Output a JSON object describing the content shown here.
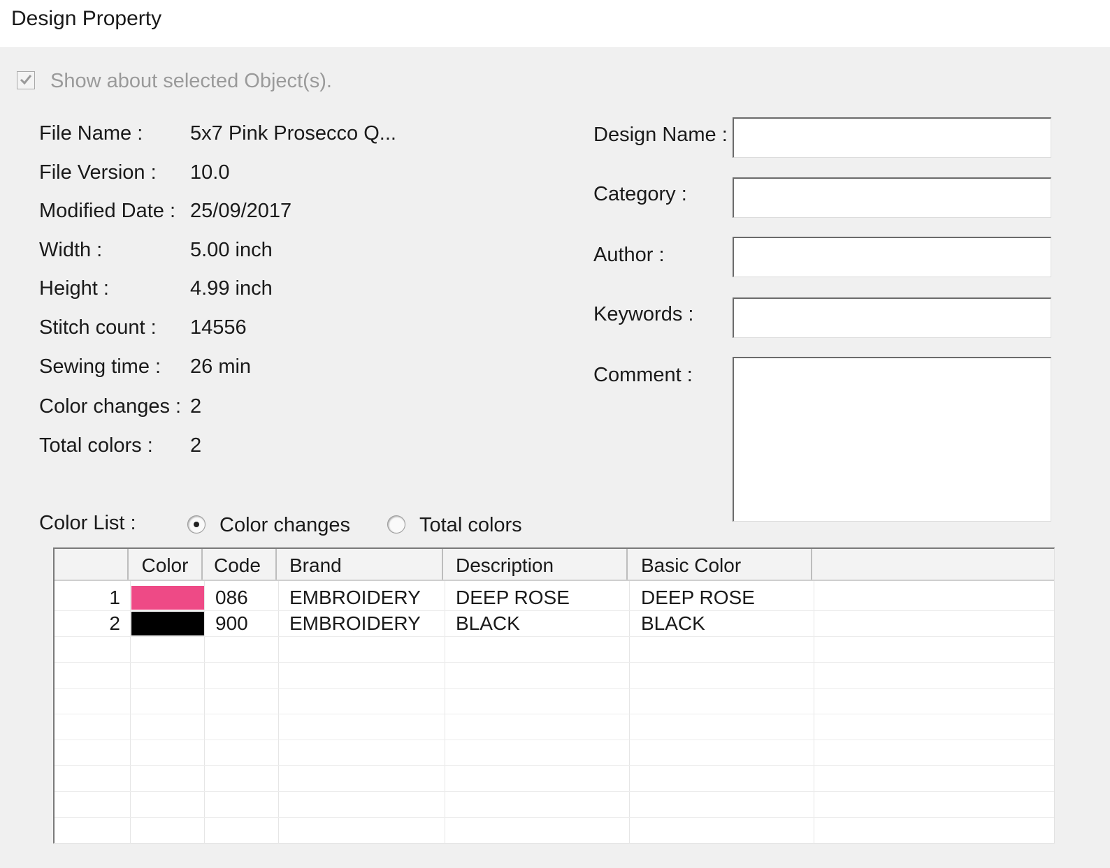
{
  "window": {
    "title": "Design Property"
  },
  "show_selected": {
    "label": "Show about selected Object(s).",
    "checked": true,
    "enabled": false
  },
  "properties": [
    {
      "key": "File Name :",
      "value": "5x7 Pink Prosecco Q..."
    },
    {
      "key": "File Version :",
      "value": "10.0"
    },
    {
      "key": "Modified Date :",
      "value": "25/09/2017"
    },
    {
      "key": "Width :",
      "value": "5.00 inch"
    },
    {
      "key": "Height :",
      "value": "4.99 inch"
    },
    {
      "key": "Stitch count :",
      "value": "14556"
    },
    {
      "key": "Sewing time :",
      "value": "26 min"
    },
    {
      "key": "Color changes :",
      "value": "2"
    },
    {
      "key": "Total colors :",
      "value": "2"
    }
  ],
  "fields": {
    "design_name": {
      "label": "Design Name :",
      "value": ""
    },
    "category": {
      "label": "Category :",
      "value": ""
    },
    "author": {
      "label": "Author :",
      "value": ""
    },
    "keywords": {
      "label": "Keywords :",
      "value": ""
    },
    "comment": {
      "label": "Comment :",
      "value": ""
    }
  },
  "color_list": {
    "label": "Color List :",
    "options": [
      {
        "label": "Color changes",
        "selected": true
      },
      {
        "label": "Total colors",
        "selected": false
      }
    ],
    "columns": [
      "",
      "Color",
      "Code",
      "Brand",
      "Description",
      "Basic Color"
    ],
    "rows": [
      {
        "index": "1",
        "color": "#ee4a86",
        "code": "086",
        "brand": "EMBROIDERY",
        "description": "DEEP ROSE",
        "basic_color": "DEEP ROSE"
      },
      {
        "index": "2",
        "color": "#000000",
        "code": "900",
        "brand": "EMBROIDERY",
        "description": "BLACK",
        "basic_color": "BLACK"
      }
    ]
  }
}
